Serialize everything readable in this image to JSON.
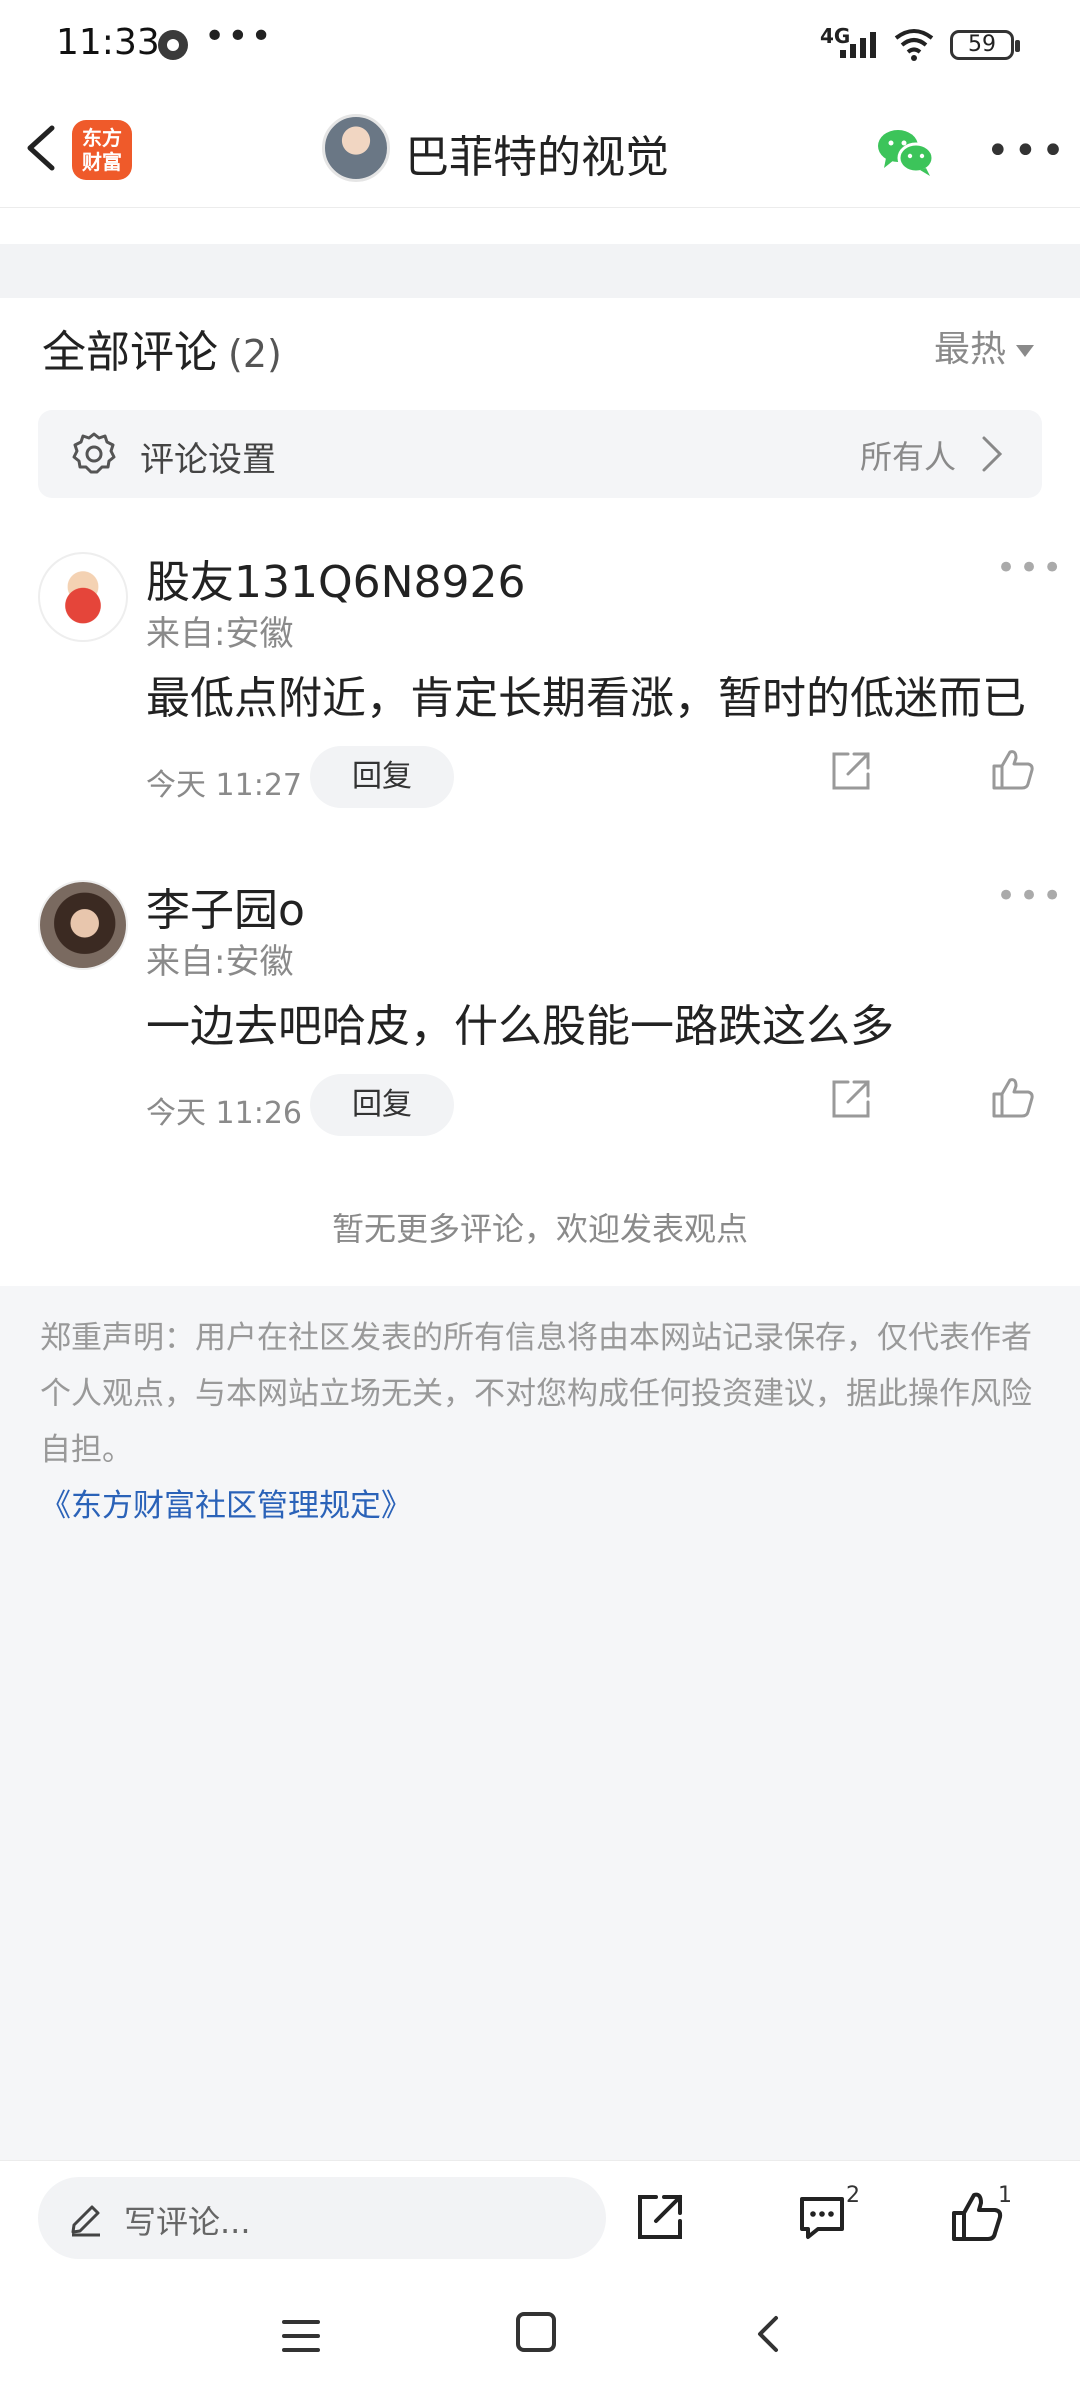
{
  "status": {
    "time": "11:33",
    "network": "4G",
    "battery": "59"
  },
  "header": {
    "app_logo": "东方\n财富",
    "author": "巴菲特的视觉"
  },
  "comments": {
    "title": "全部评论",
    "count": "(2)",
    "sort": "最热",
    "settings": {
      "label": "评论设置",
      "value": "所有人"
    },
    "items": [
      {
        "user": "股友131Q6N8926",
        "location": "来自:安徽",
        "text": "最低点附近，肯定长期看涨，暂时的低迷而已",
        "time": "今天 11:27",
        "reply": "回复"
      },
      {
        "user": "李子园o",
        "location": "来自:安徽",
        "text": "一边去吧哈皮，什么股能一路跌这么多",
        "time": "今天 11:26",
        "reply": "回复"
      }
    ],
    "no_more": "暂无更多评论，欢迎发表观点"
  },
  "footer": {
    "disclaimer": "郑重声明：用户在社区发表的所有信息将由本网站记录保存，仅代表作者个人观点，与本网站立场无关，不对您构成任何投资建议，据此操作风险自担。",
    "rules_link": "《东方财富社区管理规定》"
  },
  "bottom_bar": {
    "placeholder": "写评论...",
    "comment_badge": "2",
    "like_badge": "1"
  },
  "colors": {
    "logo": "#ef5a2a",
    "link": "#2a62b8",
    "wechat": "#3cc45a"
  },
  "icons": {
    "back": "chevron-left-icon",
    "wechat": "wechat-icon",
    "settings": "gear-icon",
    "share": "share-icon",
    "like": "thumbs-up-icon",
    "comment": "comment-icon",
    "edit": "pencil-icon"
  }
}
